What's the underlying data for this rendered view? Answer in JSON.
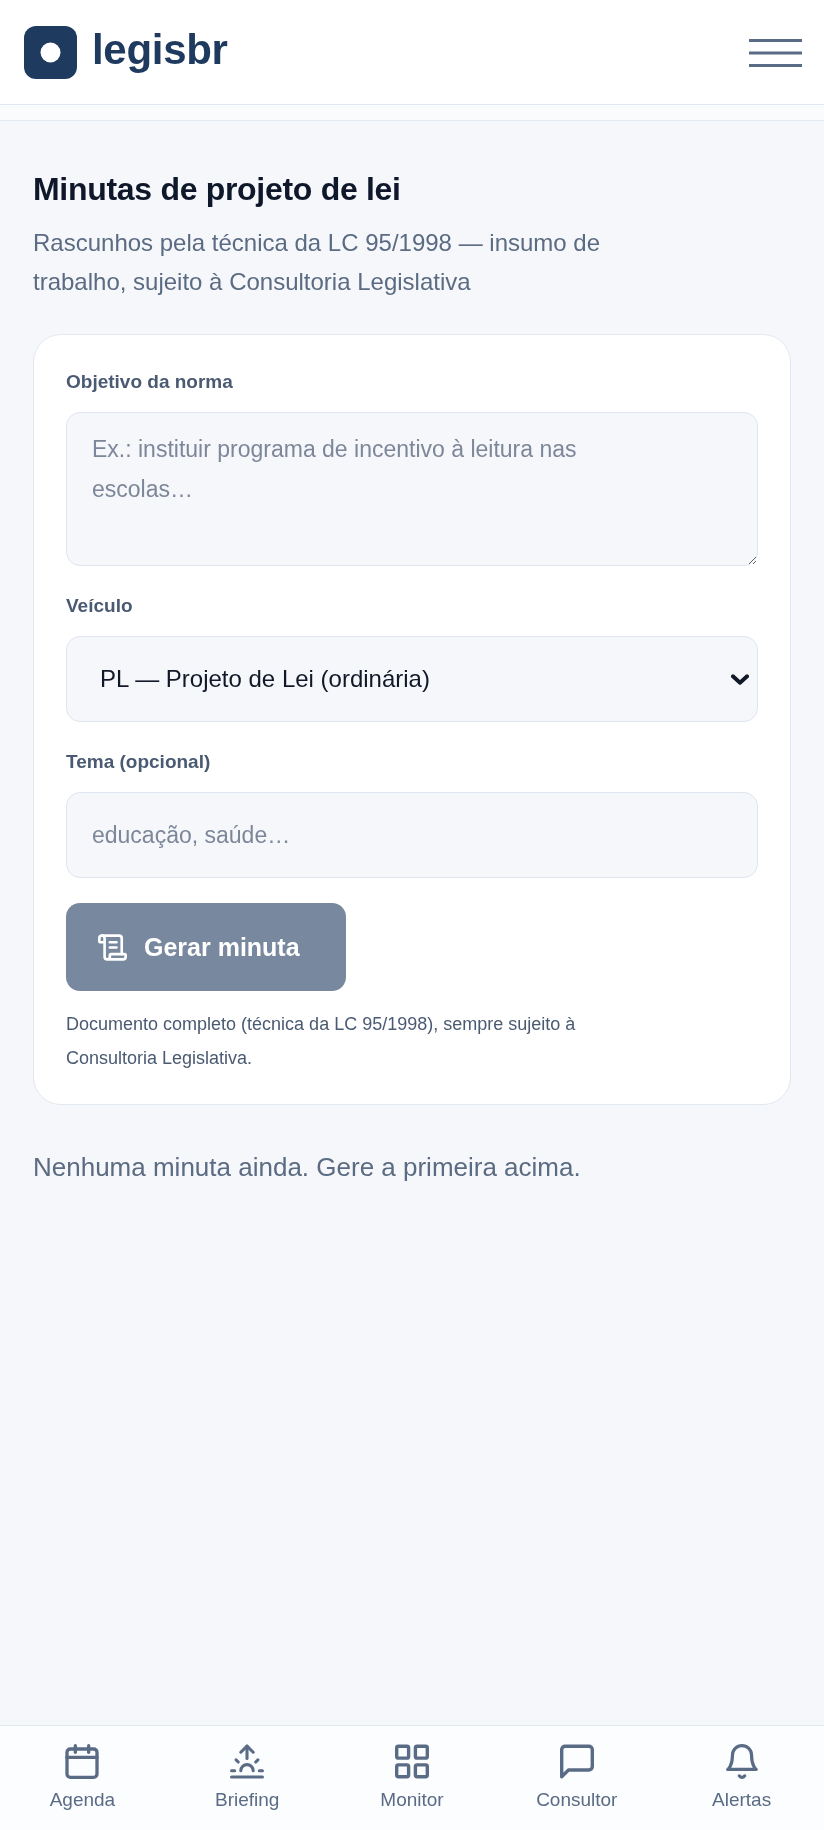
{
  "header": {
    "app_name": "legisbr"
  },
  "page": {
    "title": "Minutas de projeto de lei",
    "subtitle": "Rascunhos pela técnica da LC 95/1998 — insumo de trabalho, sujeito à Consultoria Legislativa"
  },
  "form": {
    "fields": [
      {
        "kind": "textarea",
        "label": "Objetivo da norma",
        "placeholder": "Ex.: instituir programa de incentivo à leitura nas escolas…"
      },
      {
        "kind": "select",
        "label": "Veículo",
        "value": "PL — Projeto de Lei (ordinária)"
      },
      {
        "kind": "input",
        "label": "Tema (opcional)",
        "placeholder": "educação, saúde…"
      }
    ],
    "submit": {
      "label": "Gerar minuta",
      "disabled": true
    },
    "note": "Documento completo (técnica da LC 95/1998), sempre sujeito à Consultoria Legislativa."
  },
  "empty_state": "Nenhuma minuta ainda. Gere a primeira acima.",
  "bottom_nav": [
    {
      "label": "Agenda",
      "selected": false
    },
    {
      "label": "Briefing",
      "selected": false
    },
    {
      "label": "Monitor",
      "selected": false
    },
    {
      "label": "Consultor",
      "selected": false
    },
    {
      "label": "Alertas",
      "selected": false
    }
  ]
}
